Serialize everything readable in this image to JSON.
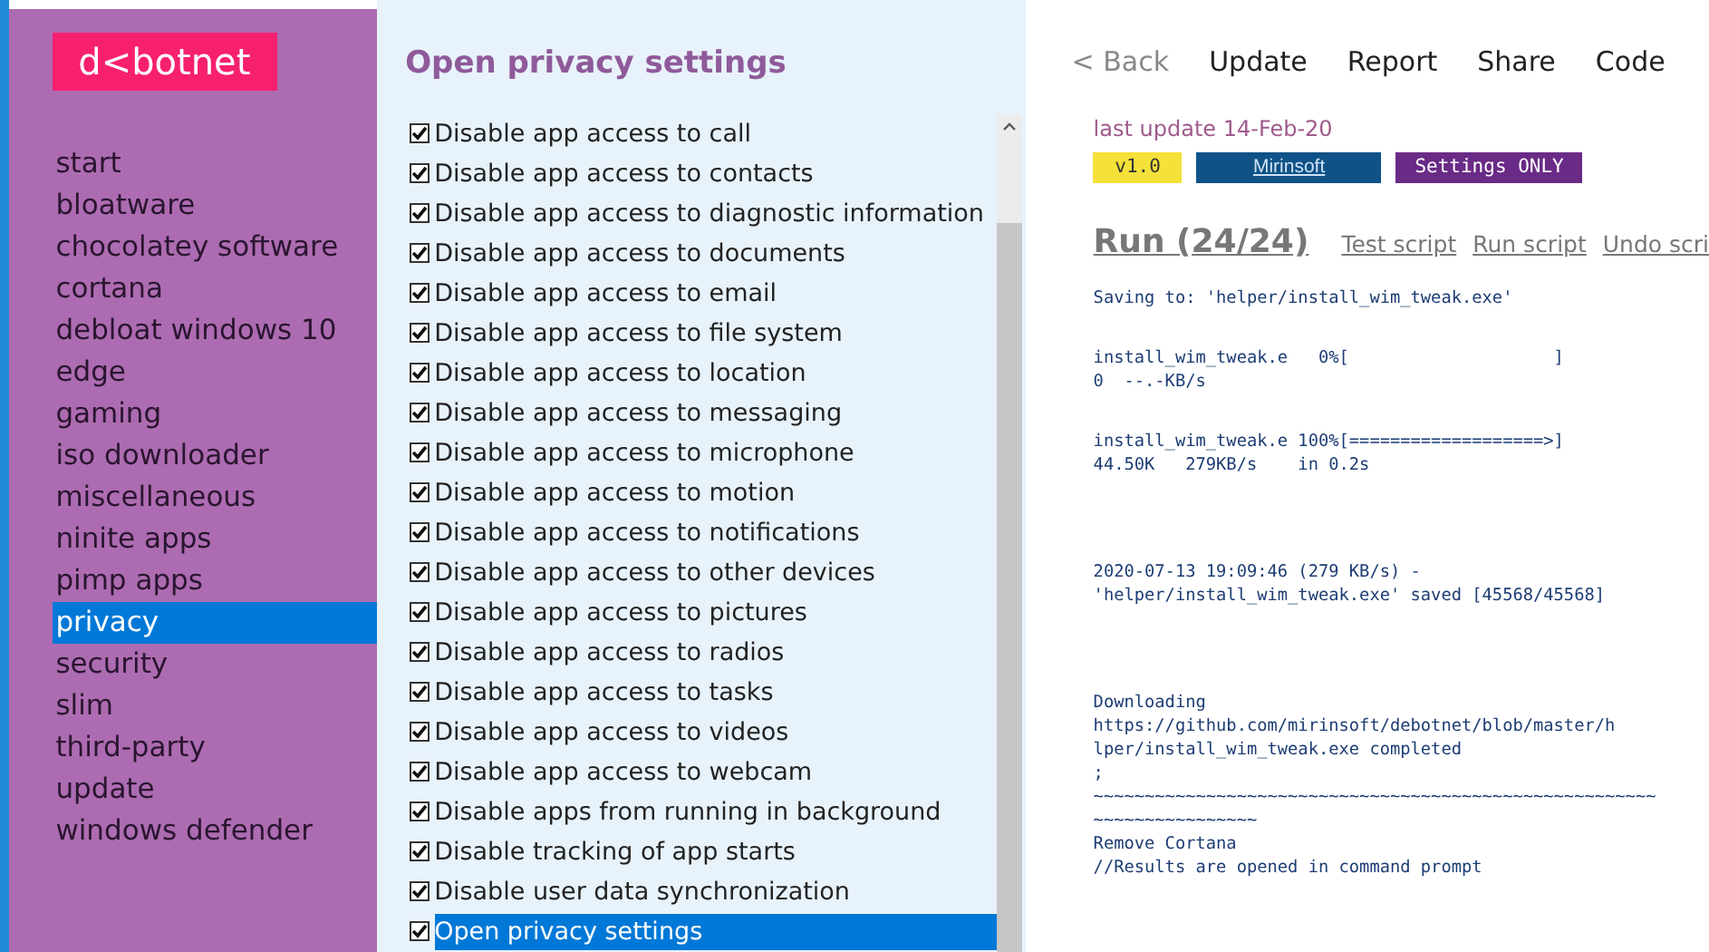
{
  "logo": "d<botnet",
  "sidebar": {
    "items": [
      {
        "label": "start",
        "selected": false
      },
      {
        "label": "bloatware",
        "selected": false
      },
      {
        "label": "chocolatey software",
        "selected": false
      },
      {
        "label": "cortana",
        "selected": false
      },
      {
        "label": "debloat windows 10",
        "selected": false
      },
      {
        "label": "edge",
        "selected": false
      },
      {
        "label": "gaming",
        "selected": false
      },
      {
        "label": "iso downloader",
        "selected": false
      },
      {
        "label": "miscellaneous",
        "selected": false
      },
      {
        "label": "ninite apps",
        "selected": false
      },
      {
        "label": "pimp apps",
        "selected": false
      },
      {
        "label": "privacy",
        "selected": true
      },
      {
        "label": "security",
        "selected": false
      },
      {
        "label": "slim",
        "selected": false
      },
      {
        "label": "third-party",
        "selected": false
      },
      {
        "label": "update",
        "selected": false
      },
      {
        "label": "windows defender",
        "selected": false
      }
    ]
  },
  "settings": {
    "title": "Open privacy settings",
    "items": [
      {
        "label": "Disable app access to call",
        "checked": true,
        "selected": false
      },
      {
        "label": "Disable app access to contacts",
        "checked": true,
        "selected": false
      },
      {
        "label": "Disable app access to diagnostic information",
        "checked": true,
        "selected": false
      },
      {
        "label": "Disable app access to documents",
        "checked": true,
        "selected": false
      },
      {
        "label": "Disable app access to email",
        "checked": true,
        "selected": false
      },
      {
        "label": "Disable app access to file system",
        "checked": true,
        "selected": false
      },
      {
        "label": "Disable app access to location",
        "checked": true,
        "selected": false
      },
      {
        "label": "Disable app access to messaging",
        "checked": true,
        "selected": false
      },
      {
        "label": "Disable app access to microphone",
        "checked": true,
        "selected": false
      },
      {
        "label": "Disable app access to motion",
        "checked": true,
        "selected": false
      },
      {
        "label": "Disable app access to notifications",
        "checked": true,
        "selected": false
      },
      {
        "label": "Disable app access to other devices",
        "checked": true,
        "selected": false
      },
      {
        "label": "Disable app access to pictures",
        "checked": true,
        "selected": false
      },
      {
        "label": "Disable app access to radios",
        "checked": true,
        "selected": false
      },
      {
        "label": "Disable app access to tasks",
        "checked": true,
        "selected": false
      },
      {
        "label": "Disable app access to videos",
        "checked": true,
        "selected": false
      },
      {
        "label": "Disable app access to webcam",
        "checked": true,
        "selected": false
      },
      {
        "label": "Disable apps from running in background",
        "checked": true,
        "selected": false
      },
      {
        "label": "Disable tracking of app starts",
        "checked": true,
        "selected": false
      },
      {
        "label": "Disable user data synchronization",
        "checked": true,
        "selected": false
      },
      {
        "label": "Open privacy settings",
        "checked": true,
        "selected": true
      }
    ]
  },
  "toolbar": {
    "back": "< Back",
    "buttons": [
      "Update",
      "Report",
      "Share",
      "Code"
    ]
  },
  "last_update": "last update 14-Feb-20",
  "badges": [
    {
      "label": "v1.0",
      "kind": "version"
    },
    {
      "label": "Mirinsoft",
      "kind": "link"
    },
    {
      "label": "Settings ONLY",
      "kind": "mode"
    }
  ],
  "run": {
    "title": "Run (24/24)",
    "links": [
      "Test script",
      "Run script",
      "Undo scri"
    ]
  },
  "log": [
    [
      "Saving to: 'helper/install_wim_tweak.exe'"
    ],
    [
      "install_wim_tweak.e   0%[                    ]",
      "0  --.-KB/s"
    ],
    [
      "install_wim_tweak.e 100%[===================>]",
      "44.50K   279KB/s    in 0.2s"
    ],
    [
      "2020-07-13 19:09:46 (279 KB/s) -",
      "'helper/install_wim_tweak.exe' saved [45568/45568]"
    ],
    [
      "Downloading",
      "https://github.com/mirinsoft/debotnet/blob/master/h",
      "lper/install_wim_tweak.exe completed",
      ";",
      "~~~~~~~~~~~~~~~~~~~~~~~~~~~~~~~~~~~~~~~~~~~~~~~~~~~~~~~",
      "~~~~~~~~~~~~~~~~",
      "Remove Cortana",
      "//Results are opened in command prompt"
    ]
  ]
}
